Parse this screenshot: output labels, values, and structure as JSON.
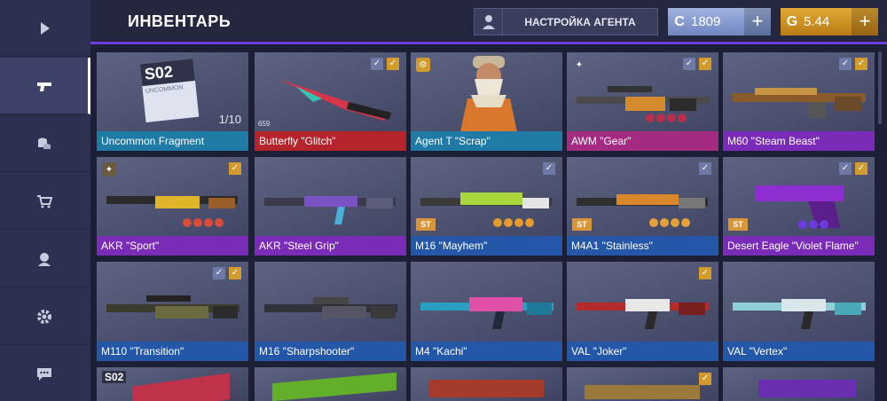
{
  "header": {
    "title": "ИНВЕНТАРЬ",
    "agent_button": "НАСТРОЙКА АГЕНТА",
    "credits": {
      "symbol": "C",
      "value": "1809",
      "plus": "+"
    },
    "gold": {
      "symbol": "G",
      "value": "5.44",
      "plus": "+"
    }
  },
  "sidebar": {
    "items": [
      {
        "icon": "play-icon"
      },
      {
        "icon": "gun-icon",
        "active": true
      },
      {
        "icon": "coins-icon"
      },
      {
        "icon": "cart-icon"
      },
      {
        "icon": "agent-icon"
      },
      {
        "icon": "gear-icon"
      },
      {
        "icon": "chat-icon"
      }
    ]
  },
  "inventory": {
    "rows": [
      [
        {
          "label": "Uncommon Fragment",
          "count": "1/10",
          "fragment_code": "S02",
          "fragment_text": "UNCOMMON"
        },
        {
          "label": "Butterfly \"Glitch\"",
          "small": "659"
        },
        {
          "label": "Agent T \"Scrap\""
        },
        {
          "label": "AWM \"Gear\""
        },
        {
          "label": "M60 \"Steam Beast\""
        }
      ],
      [
        {
          "label": "AKR \"Sport\""
        },
        {
          "label": "AKR \"Steel Grip\""
        },
        {
          "label": "M16 \"Mayhem\"",
          "st": "ST"
        },
        {
          "label": "M4A1 \"Stainless\"",
          "st": "ST"
        },
        {
          "label": "Desert Eagle \"Violet Flame\"",
          "st": "ST"
        }
      ],
      [
        {
          "label": "M110 \"Transition\""
        },
        {
          "label": "M16 \"Sharpshooter\""
        },
        {
          "label": "M4 \"Kachi\""
        },
        {
          "label": "VAL \"Joker\""
        },
        {
          "label": "VAL \"Vertex\""
        }
      ],
      [
        {
          "label": "",
          "fragment_code": "S02"
        },
        {
          "label": ""
        },
        {
          "label": ""
        },
        {
          "label": ""
        },
        {
          "label": ""
        }
      ]
    ]
  },
  "colors": {
    "rarity_uncommon": "#1f7aa6",
    "rarity_red": "#b5232b",
    "rarity_purple": "#7a2bb8",
    "rarity_magenta": "#a42a82",
    "rarity_blue": "#2557a8",
    "accent": "#6a3ddb"
  }
}
